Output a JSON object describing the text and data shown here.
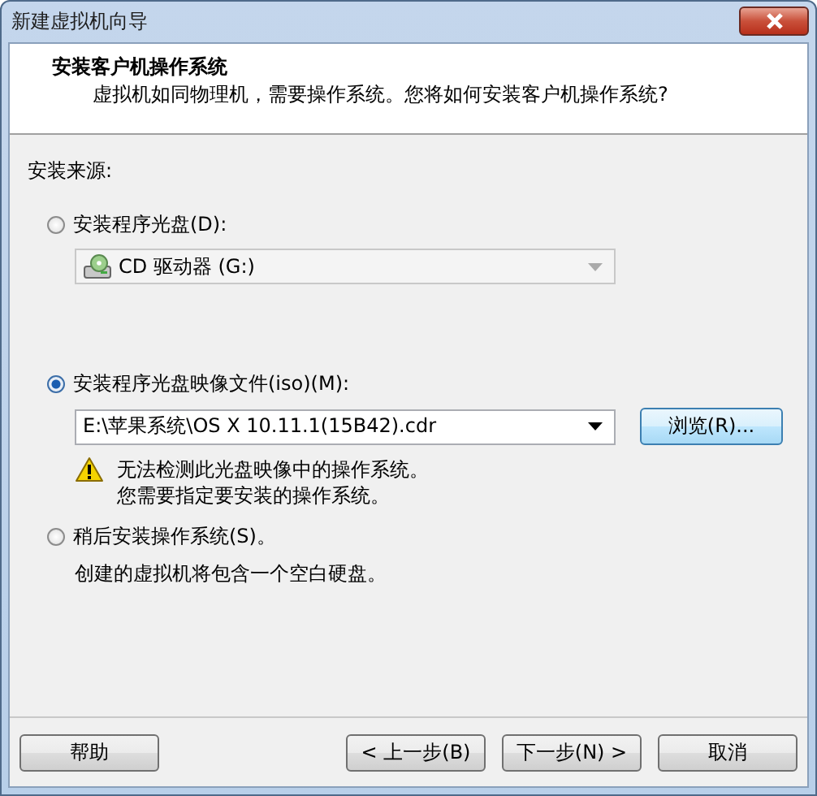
{
  "window": {
    "title": "新建虚拟机向导"
  },
  "header": {
    "title": "安装客户机操作系统",
    "subtitle": "虚拟机如同物理机，需要操作系统。您将如何安装客户机操作系统?"
  },
  "section_label": "安装来源:",
  "options": [
    {
      "kind": "drive",
      "label": "安装程序光盘(D):",
      "selected": false,
      "combo": {
        "value": "CD 驱动器 (G:)",
        "disabled": true
      }
    },
    {
      "kind": "image",
      "label": "安装程序光盘映像文件(iso)(M):",
      "selected": true,
      "combo": {
        "value": "E:\\苹果系统\\OS X 10.11.1(15B42).cdr",
        "disabled": false
      },
      "browse": "浏览(R)...",
      "warning": [
        "无法检测此光盘映像中的操作系统。",
        "您需要指定要安装的操作系统。"
      ]
    },
    {
      "kind": "later",
      "label": "稍后安装操作系统(S)。",
      "selected": false,
      "note": "创建的虚拟机将包含一个空白硬盘。"
    }
  ],
  "buttons": {
    "help": "帮助",
    "back": "< 上一步(B)",
    "next": "下一步(N) >",
    "cancel": "取消"
  }
}
